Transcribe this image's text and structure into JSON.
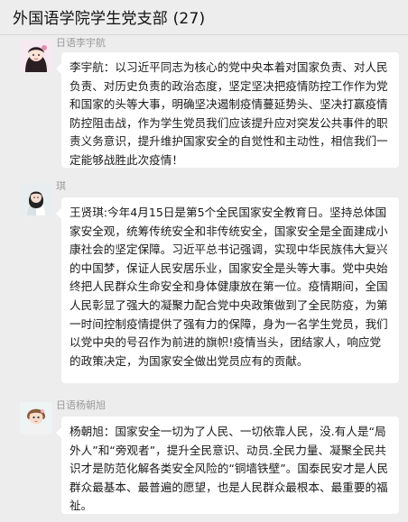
{
  "header": {
    "title": "外国语学院学生党支部 (27)"
  },
  "colors": {
    "background": "#ededed",
    "bubble": "#ffffff",
    "name": "#9a9a9a"
  },
  "messages": [
    {
      "sender": "日语李宇航",
      "avatar_icon": "girl-cartoon-avatar-icon",
      "text": "李宇航：以习近平同志为核心的党中央本着对国家负责、对人民负责、对历史负责的政治态度，坚定坚决把疫情防控工作作为党和国家的头等大事，明确坚决遏制疫情蔓延势头、坚决打赢疫情防控阻击战，作为学生党员我们应该提升应对突发公共事件的职责义务意识，提升维护国家安全的自觉性和主动性，相信我们一定能够战胜此次疫情！"
    },
    {
      "sender": "琪",
      "avatar_icon": "girl-portrait-avatar-icon",
      "text": "王贤琪:今年4月15日是第5个全民国家安全教育日。坚持总体国家安全观，统筹传统安全和非传统安全，国家安全是全面建成小康社会的坚定保障。习近平总书记强调，实现中华民族伟大复兴的中国梦，保证人民安居乐业，国家安全是头等大事。党中央始终把人民群众生命安全和身体健康放在第一位。疫情期间，全国人民彰显了强大的凝聚力配合党中央政策做到了全民防疫，为第一时间控制疫情提供了强有力的保障，身为一名学生党员，我们以党中央的号召作为前进的旗帜!疫情当头，团结家人，响应党的政策决定，为国家安全做出党员应有的贡献。"
    },
    {
      "sender": "日语杨朝旭",
      "avatar_icon": "child-photo-avatar-icon",
      "text": "杨朝旭：国家安全一切为了人民、一切依靠人民，没.有人是“局外人”和“旁观者”，提升全民意识、动员.全民力量、凝聚全民共识才是防范化解各类安全风险的“铜墙铁壁”。国泰民安才是人民群众最基本、最普遍的愿望，也是人民群众最根本、最重要的福祉。"
    }
  ]
}
